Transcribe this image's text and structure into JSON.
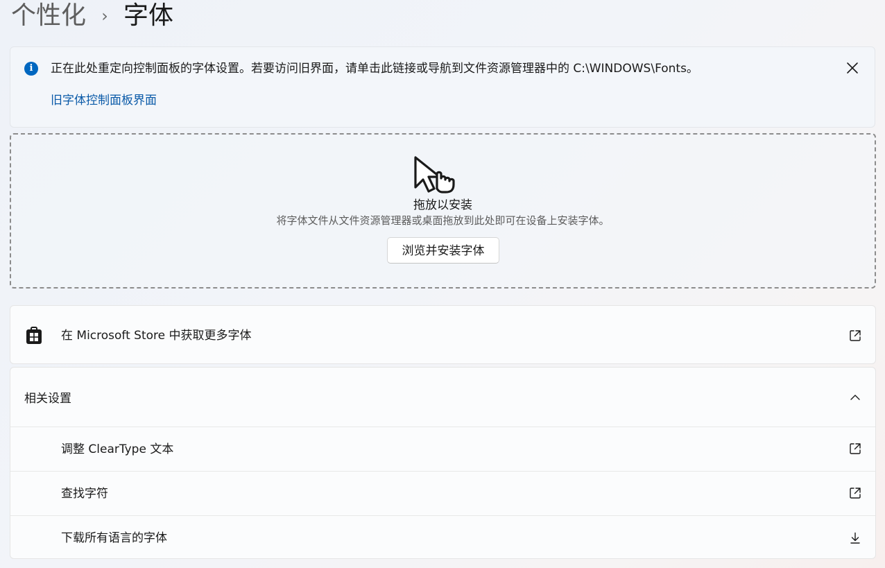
{
  "breadcrumb": {
    "parent": "个性化",
    "separator": "›",
    "current": "字体"
  },
  "info_bar": {
    "message": "正在此处重定向控制面板的字体设置。若要访问旧界面，请单击此链接或导航到文件资源管理器中的 C:\\WINDOWS\\Fonts。",
    "link": "旧字体控制面板界面",
    "icon": "info-icon",
    "close_icon": "close-icon",
    "accent": "#0067c0"
  },
  "drop_zone": {
    "title": "拖放以安装",
    "description": "将字体文件从文件资源管理器或桌面拖放到此处即可在设备上安装字体。",
    "browse_button": "浏览并安装字体",
    "icon": "drag-drop-hand-icon"
  },
  "store": {
    "label": "在 Microsoft Store 中获取更多字体",
    "icon": "store-icon",
    "action_icon": "external-link-icon"
  },
  "related_settings": {
    "title": "相关设置",
    "expanded_icon": "chevron-up-icon",
    "items": [
      {
        "label": "调整 ClearType 文本",
        "icon": "external-link-icon"
      },
      {
        "label": "查找字符",
        "icon": "external-link-icon"
      },
      {
        "label": "下载所有语言的字体",
        "icon": "download-icon"
      }
    ]
  }
}
